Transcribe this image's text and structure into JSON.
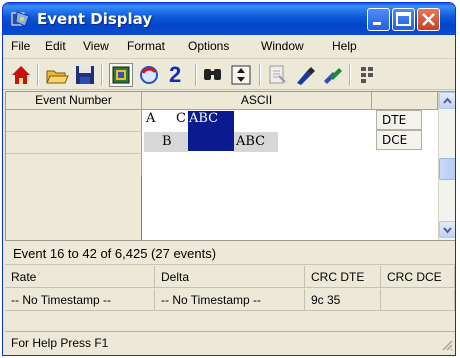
{
  "window": {
    "title": "Event Display"
  },
  "menu": [
    "File",
    "Edit",
    "View",
    "Format",
    "Options",
    "Window",
    "Help"
  ],
  "toolbar": {
    "icons": [
      "home-icon",
      "open-folder-icon",
      "save-icon",
      "frame-icon",
      "cycle-icon",
      "number-two-icon",
      "find-icon",
      "jump-icon",
      "document-icon",
      "pen-icon",
      "pens-icon",
      "grid-icon"
    ],
    "number_label": "2"
  },
  "grid": {
    "headers": {
      "event_number": "Event Number",
      "ascii": "ASCII"
    },
    "row1": {
      "a": "A",
      "c": "C",
      "sel": "ABC"
    },
    "row2": {
      "b": "B",
      "abc": "ABC"
    },
    "labels": {
      "dte": "DTE",
      "dce": "DCE"
    }
  },
  "info": "Event 16 to 42 of 6,425 (27 events)",
  "timestamp": {
    "headers": {
      "rate": "Rate",
      "delta": "Delta",
      "crc_dte": "CRC DTE",
      "crc_dce": "CRC DCE"
    },
    "values": {
      "rate": "-- No Timestamp --",
      "delta": "-- No Timestamp --",
      "crc_dte": "9c 35",
      "crc_dce": ""
    }
  },
  "status": "For Help Press F1",
  "colors": {
    "selection": "#0a1b8f",
    "title_bar": "#0346c8",
    "close_button": "#c8421e"
  }
}
